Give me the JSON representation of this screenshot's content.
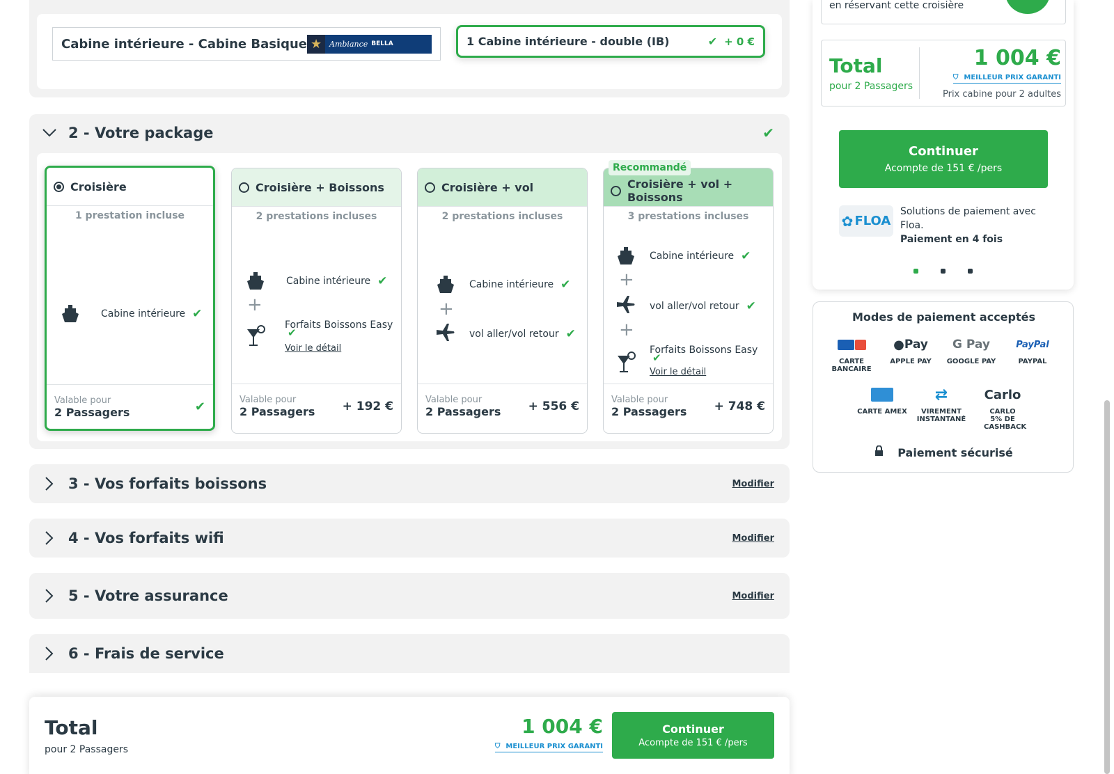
{
  "cabin": {
    "title": "Cabine intérieure - Cabine Basique",
    "logo_brand": "Ambiance",
    "logo_name": "BELLA",
    "selected_label": "1 Cabine intérieure - double (IB)",
    "selected_price": "+ 0 €"
  },
  "sections": {
    "package": "2 - Votre package",
    "boissons": "3 - Vos forfaits boissons",
    "wifi": "4 - Vos forfaits wifi",
    "assurance": "5 - Votre assurance",
    "frais": "6 - Frais de service",
    "modify": "Modifier"
  },
  "packages": {
    "recommended": "Recommandé",
    "valid_for": "Valable pour",
    "passengers": "2 Passagers",
    "detail_link": "Voir le détail",
    "cabin_item": "Cabine intérieure",
    "drinks_item": "Forfaits Boissons Easy",
    "flight_item": "vol aller/vol retour",
    "cards": [
      {
        "title": "Croisière",
        "sub": "1 prestation incluse",
        "price": ""
      },
      {
        "title": "Croisière + Boissons",
        "sub": "2 prestations incluses",
        "price": "+ 192 €"
      },
      {
        "title": "Croisière + vol",
        "sub": "2 prestations incluses",
        "price": "+ 556 €"
      },
      {
        "title": "Croisière + vol + Boissons",
        "sub": "3 prestations incluses",
        "price": "+ 748 €"
      }
    ]
  },
  "summary": {
    "promo_text": "en réservant cette croisière",
    "total_label": "Total",
    "passengers": "pour 2 Passagers",
    "total_price": "1 004 €",
    "garanti": "MEILLEUR PRIX GARANTI",
    "price_note": "Prix cabine pour 2 adultes",
    "continue": "Continuer",
    "deposit": "Acompte de 151 € /pers",
    "floa_brand": "FLOA",
    "floa_text": "Solutions de paiement avec Floa.",
    "floa_bold": "Paiement en 4 fois"
  },
  "payment": {
    "title": "Modes de paiement acceptés",
    "methods": [
      {
        "label": "CARTE BANCAIRE",
        "icon": "credit-card-icon"
      },
      {
        "label": "APPLE PAY",
        "icon": "apple-pay-icon",
        "logo": "Pay"
      },
      {
        "label": "GOOGLE PAY",
        "icon": "google-pay-icon",
        "logo": "G Pay"
      },
      {
        "label": "PAYPAL",
        "icon": "paypal-icon",
        "logo": "PayPal"
      },
      {
        "label": "CARTE AMEX",
        "icon": "amex-icon"
      },
      {
        "label": "VIREMENT INSTANTANÉ",
        "icon": "bank-transfer-icon"
      },
      {
        "label": "CARLO 5% DE CASHBACK",
        "icon": "carlo-icon",
        "logo": "Carlo"
      }
    ],
    "secure": "Paiement sécurisé"
  },
  "colors": {
    "accent": "#2eab4b",
    "blue": "#1a8fd0",
    "text": "#2b3a44"
  }
}
